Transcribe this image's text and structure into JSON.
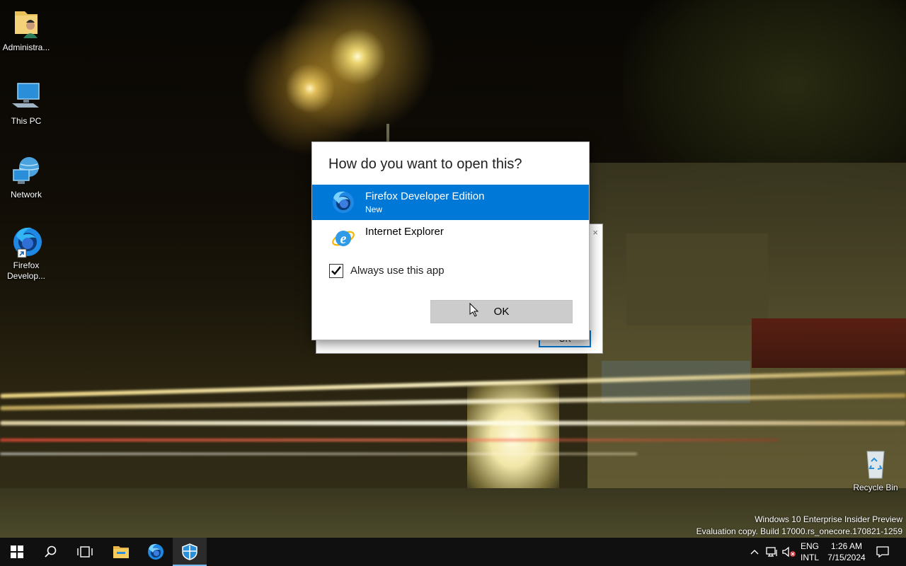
{
  "desktop": {
    "icons": [
      {
        "label": "Administra...",
        "icon": "user-folder-icon"
      },
      {
        "label": "This PC",
        "icon": "computer-icon"
      },
      {
        "label": "Network",
        "icon": "network-globe-icon"
      },
      {
        "label": "Firefox\nDevelop...",
        "icon": "firefox-developer-shortcut-icon"
      },
      {
        "label": "Recycle Bin",
        "icon": "recycle-bin-icon"
      }
    ]
  },
  "background_dialog": {
    "ok_label": "OK",
    "close_glyph": "×"
  },
  "dialog": {
    "title": "How do you want to open this?",
    "apps": [
      {
        "name": "Firefox Developer Edition",
        "subtitle": "New",
        "selected": true,
        "icon": "firefox-developer-icon"
      },
      {
        "name": "Internet Explorer",
        "subtitle": "",
        "selected": false,
        "icon": "internet-explorer-icon"
      }
    ],
    "always_use_label": "Always use this app",
    "always_use_checked": true,
    "ok_label": "OK"
  },
  "watermark": {
    "line1": "Windows 10 Enterprise Insider Preview",
    "line2": "Evaluation copy. Build 17000.rs_onecore.170821-1259"
  },
  "taskbar": {
    "buttons": [
      {
        "icon": "windows-start-icon"
      },
      {
        "icon": "search-icon"
      },
      {
        "icon": "task-view-icon"
      },
      {
        "icon": "file-explorer-icon"
      },
      {
        "icon": "firefox-developer-icon"
      },
      {
        "icon": "shield-app-icon",
        "active": true
      }
    ],
    "tray": {
      "lang_line1": "ENG",
      "lang_line2": "INTL",
      "time": "1:26 AM",
      "date": "7/15/2024"
    }
  },
  "colors": {
    "selection": "#0078d7",
    "taskbar": "#101010",
    "ok_button": "#cccccc"
  }
}
